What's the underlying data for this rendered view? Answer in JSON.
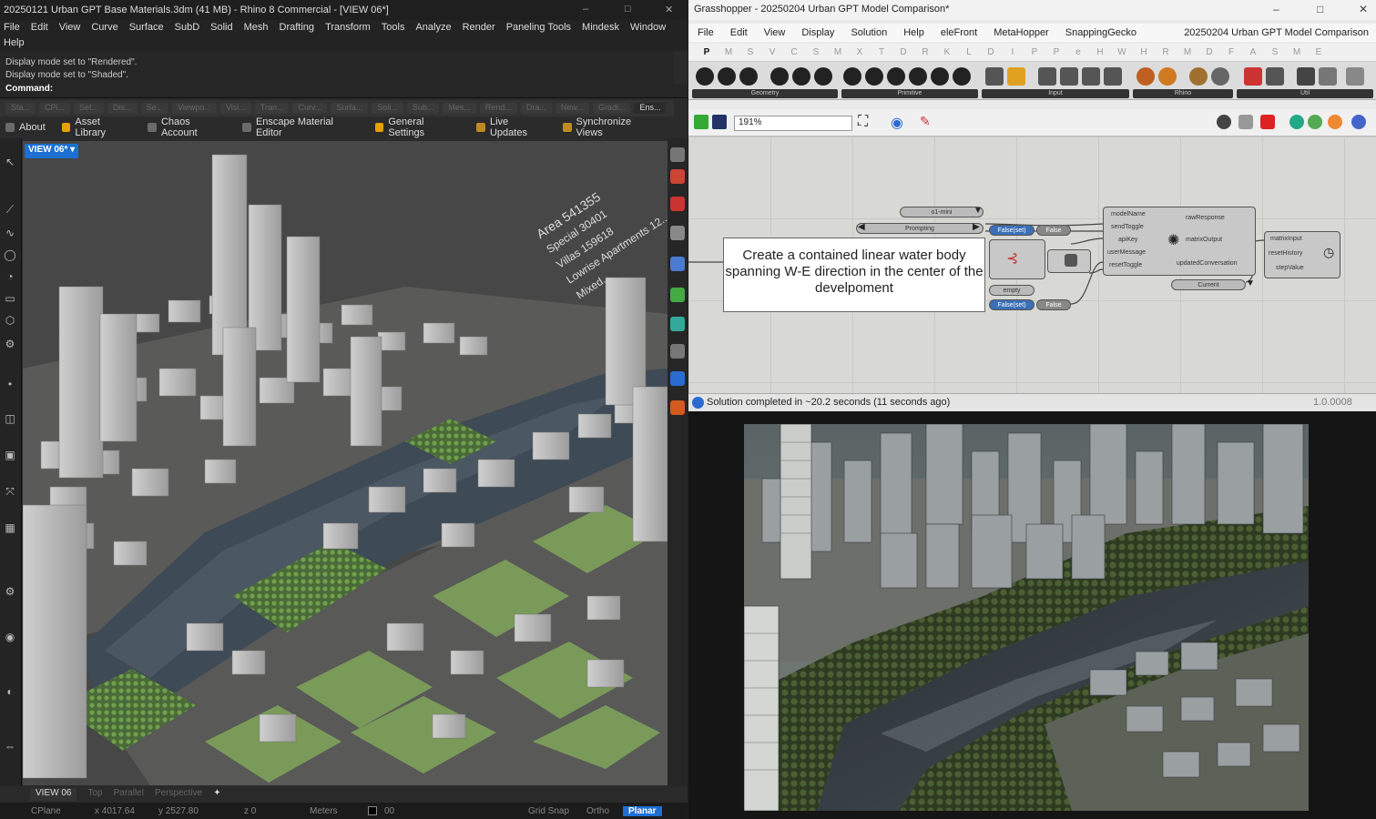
{
  "rhino": {
    "title": "20250121 Urban GPT Base Materials.3dm (41 MB) - Rhino 8 Commercial - [VIEW 06*]",
    "menu": [
      "File",
      "Edit",
      "View",
      "Curve",
      "Surface",
      "SubD",
      "Solid",
      "Mesh",
      "Drafting",
      "Transform",
      "Tools",
      "Analyze",
      "Render",
      "Paneling Tools",
      "Mindesk",
      "Window"
    ],
    "help": "Help",
    "history": [
      "Display mode set to \"Rendered\".",
      "Display mode set to \"Shaded\"."
    ],
    "command_label": "Command:",
    "toolbar_tabs": [
      "Sta...",
      "CPl...",
      "Set...",
      "Dis...",
      "Se...",
      "Viewpo...",
      "Visi...",
      "Tran...",
      "Curv...",
      "Surfa...",
      "Soli...",
      "Sub...",
      "Mes...",
      "Rend...",
      "Dra...",
      "New...",
      "Gradi...",
      "Ens..."
    ],
    "toolbar_items": [
      "About",
      "Asset Library",
      "Chaos Account",
      "Enscape Material Editor",
      "General Settings",
      "Live Updates",
      "Synchronize Views"
    ],
    "viewport_label": "VIEW 06*",
    "viewport_text": [
      "Area  541355",
      "Special  30401",
      "Villas  159618",
      "Lowrise Apartments  12...",
      "Mixed..."
    ],
    "viewport_tabs": [
      "VIEW 06",
      "Top",
      "Parallel",
      "Perspective"
    ],
    "status": {
      "cplane": "CPlane",
      "x": "x 4017.64",
      "y": "y 2527.80",
      "z": "z 0",
      "units": "Meters",
      "layer": "00",
      "grid_snap": "Grid Snap",
      "ortho": "Ortho",
      "planar": "Planar"
    }
  },
  "grasshopper": {
    "title": "Grasshopper - 20250204 Urban GPT Model Comparison*",
    "menu": [
      "File",
      "Edit",
      "View",
      "Display",
      "Solution",
      "Help",
      "eleFront",
      "MetaHopper",
      "SnappingGecko"
    ],
    "doc_name": "20250204 Urban GPT Model Comparison",
    "tabs": [
      "P",
      "M",
      "S",
      "V",
      "C",
      "S",
      "M",
      "X",
      "T",
      "D",
      "R",
      "K",
      "L",
      "D",
      "I",
      "P",
      "P",
      "e",
      "H",
      "W",
      "H",
      "R",
      "M",
      "D",
      "F",
      "A",
      "S",
      "M",
      "E"
    ],
    "ribbon_sections": [
      "Geometry",
      "Primitive",
      "Input",
      "Rhino",
      "Util"
    ],
    "zoom": "191%",
    "panel_text": "Create a contained linear water body spanning W-E direction in the center of the develpoment",
    "node_labels": {
      "model_value": "o1-mini",
      "prompting": "Prompting",
      "false1": "False",
      "false2": "False",
      "toggle_a": "False(set)",
      "toggle_b": "False(set)",
      "empty": "empty",
      "inputs": [
        "modelName",
        "sendToggle",
        "apiKey",
        "userMessage",
        "resetToggle"
      ],
      "outputs": [
        "rawResponse",
        "matrixOutput",
        "updatedConversation"
      ],
      "current": "Current",
      "timer_inputs": [
        "matrixInput",
        "resetHistory",
        "stepValue"
      ]
    },
    "status": "Solution completed in ~20.2 seconds (11 seconds ago)",
    "version": "1.0.0008"
  },
  "colors": {
    "accent": "#1d6fd2",
    "rhino_bg": "#2b2b2b",
    "gh_canvas": "#d8d8d5",
    "water": "#3e4a55"
  }
}
